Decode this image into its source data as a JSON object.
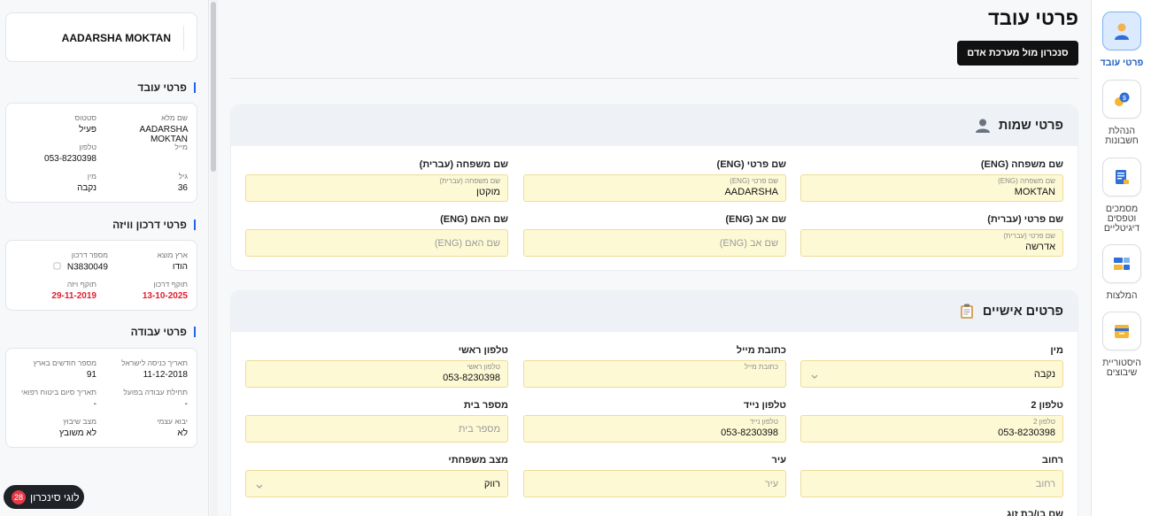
{
  "page": {
    "title": "פרטי עובד",
    "sync_button": "סנכרון מול מערכת אדם"
  },
  "nav": [
    {
      "label": "פרטי עובד",
      "icon": "person-icon",
      "active": true
    },
    {
      "label": "הנהלת חשבונות",
      "icon": "coins-icon",
      "active": false
    },
    {
      "label": "מסמכים וטפסים דיגיטליים",
      "icon": "document-icon",
      "active": false
    },
    {
      "label": "המלצות",
      "icon": "cards-icon",
      "active": false
    },
    {
      "label": "היסטוריית שיבוצים",
      "icon": "archive-box-icon",
      "active": false
    }
  ],
  "names_section": {
    "title": "פרטי שמות",
    "fields": {
      "last_name_eng": {
        "label": "שם משפחה (ENG)",
        "placeholder": "שם משפחה (ENG)",
        "value": "MOKTAN"
      },
      "first_name_eng": {
        "label": "שם פרטי (ENG)",
        "placeholder": "שם פרטי (ENG)",
        "value": "AADARSHA"
      },
      "last_name_heb": {
        "label": "שם משפחה (עברית)",
        "placeholder": "שם משפחה (עברית)",
        "value": "מוקטן"
      },
      "first_name_heb": {
        "label": "שם פרטי (עברית)",
        "placeholder": "שם פרטי (עברית)",
        "value": "אדרשה"
      },
      "father_name": {
        "label": "שם אב (ENG)",
        "placeholder": "שם אב (ENG)",
        "value": ""
      },
      "mother_name": {
        "label": "שם האם (ENG)",
        "placeholder": "שם האם (ENG)",
        "value": ""
      }
    }
  },
  "personal_section": {
    "title": "פרטים אישיים",
    "fields": {
      "gender": {
        "label": "מין",
        "value": "נקבה"
      },
      "email": {
        "label": "כתובת מייל",
        "placeholder": "כתובת מייל",
        "value": ""
      },
      "main_phone": {
        "label": "טלפון ראשי",
        "placeholder": "טלפון ראשי",
        "value": "053-8230398"
      },
      "phone2": {
        "label": "טלפון 2",
        "placeholder": "טלפון 2",
        "value": "053-8230398"
      },
      "mobile": {
        "label": "טלפון נייד",
        "placeholder": "טלפון נייד",
        "value": "053-8230398"
      },
      "house_number": {
        "label": "מספר בית",
        "placeholder": "מספר בית",
        "value": ""
      },
      "street": {
        "label": "רחוב",
        "placeholder": "רחוב",
        "value": ""
      },
      "city": {
        "label": "עיר",
        "placeholder": "עיר",
        "value": ""
      },
      "marital": {
        "label": "מצב משפחתי",
        "value": "רווק"
      },
      "spouse": {
        "label": "שם בן/בת זוג"
      }
    }
  },
  "summary": {
    "name": "AADARSHA MOKTAN",
    "employee": {
      "title": "פרטי עובד",
      "full_name_label": "שם מלא",
      "full_name": "AADARSHA MOKTAN",
      "status_label": "סטטוס",
      "status": "פעיל",
      "email_label": "מייל",
      "phone_label": "טלפון",
      "phone": "053-8230398",
      "age_label": "גיל",
      "age": "36",
      "gender_label": "מין",
      "gender": "נקבה"
    },
    "passport": {
      "title": "פרטי דרכון וויזה",
      "country_label": "ארץ מוצא",
      "country": "הודו",
      "passport_label": "מספר דרכון",
      "passport": "N3830049",
      "passport_exp_label": "תוקף דרכון",
      "passport_exp": "13-10-2025",
      "visa_exp_label": "תוקף ויזה",
      "visa_exp": "29-11-2019"
    },
    "work": {
      "title": "פרטי עבודה",
      "entry_label": "תאריך כניסה לישראל",
      "entry": "11-12-2018",
      "months_label": "מספר חודשים בארץ",
      "months": "91",
      "start_label": "תחילת עבודה בפועל",
      "start": "-",
      "insurance_label": "תאריך סיום ביטוח רפואי",
      "insurance": "-",
      "self_import_label": "יבוא עצמי",
      "self_import": "לא",
      "placement_label": "מצב שיבוץ",
      "placement": "לא משובץ"
    }
  },
  "floating": {
    "label": "לוגי סינכרון",
    "count": "28"
  }
}
